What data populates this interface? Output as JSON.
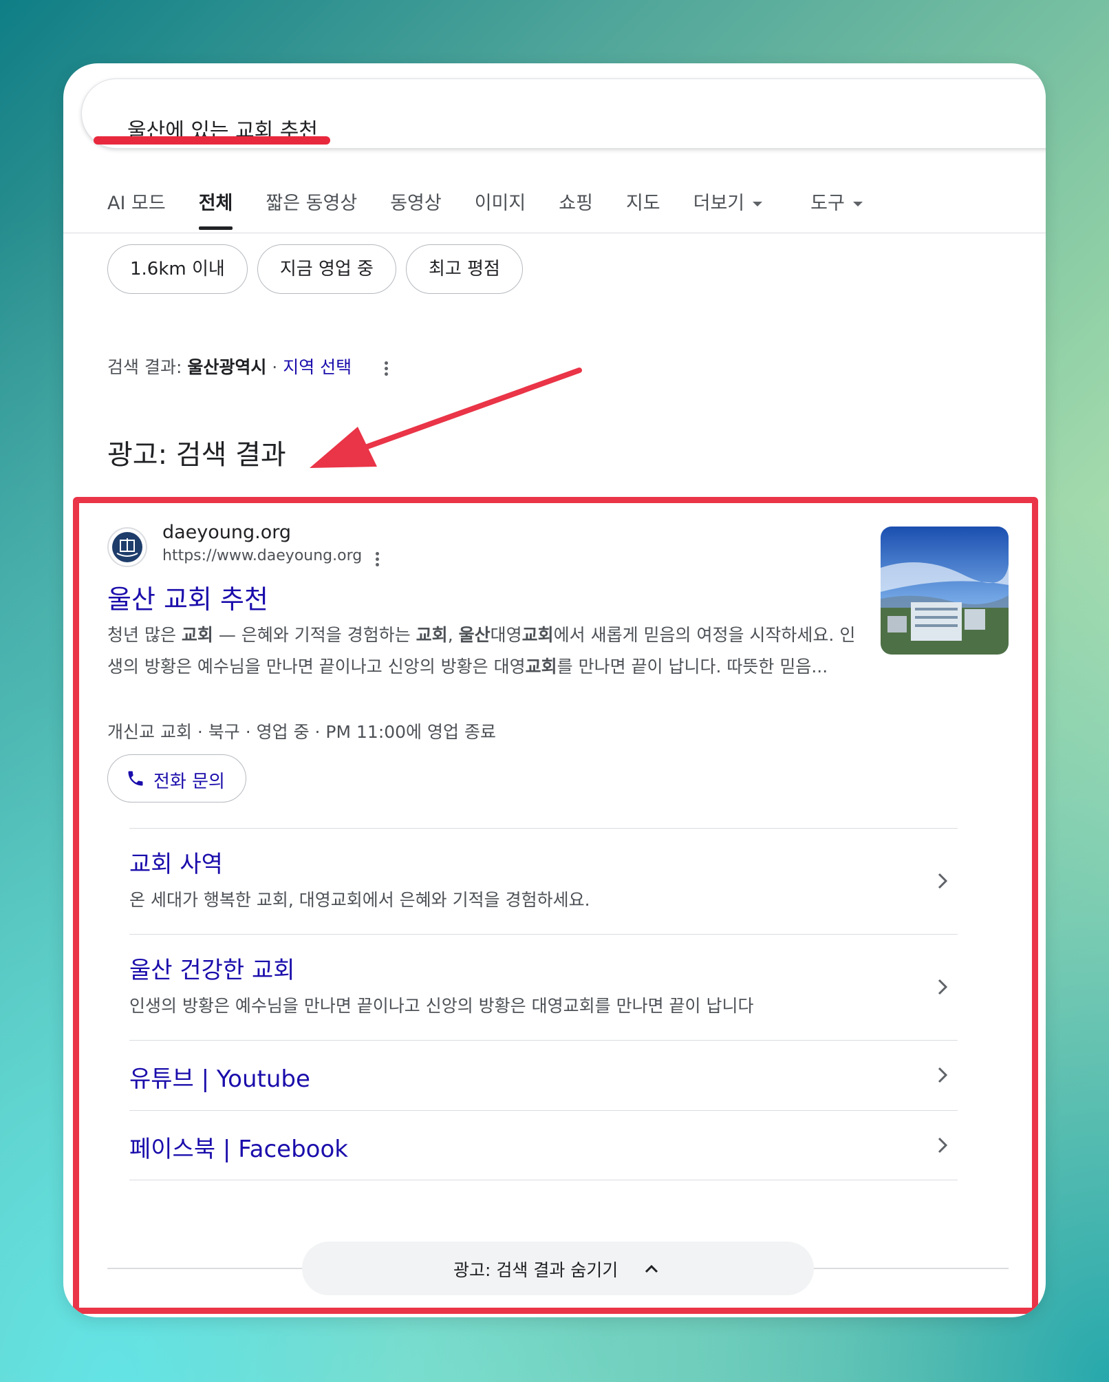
{
  "search": {
    "query": "울산에 있는 교회 추천"
  },
  "tabs": [
    {
      "label": "AI 모드"
    },
    {
      "label": "전체"
    },
    {
      "label": "짧은 동영상"
    },
    {
      "label": "동영상"
    },
    {
      "label": "이미지"
    },
    {
      "label": "쇼핑"
    },
    {
      "label": "지도"
    },
    {
      "label": "더보기"
    },
    {
      "label": "도구"
    }
  ],
  "chips": [
    "1.6km 이내",
    "지금 영업 중",
    "최고 평점"
  ],
  "location": {
    "prefix": "검색 결과: ",
    "place": "울산광역시",
    "separator": " · ",
    "link": "지역 선택"
  },
  "ad_heading": "광고: 검색 결과",
  "result": {
    "site_name": "daeyoung.org",
    "site_url": "https://www.daeyoung.org",
    "title": "울산 교회 추천",
    "snippet_parts": [
      "청년 많은 ",
      "교회",
      " — 은혜와 기적을 경험하는 ",
      "교회",
      ", ",
      "울산",
      "대영",
      "교회",
      "에서 새롭게 믿음의 여정을 시작하세요. 인생의 방황은 예수님을 만나면 끝이나고 신앙의 방황은 대영",
      "교회",
      "를 만나면 끝이 납니다. 따뜻한 믿음..."
    ],
    "meta": "개신교 교회 · 북구 · 영업 중 · PM 11:00에 영업 종료",
    "call_label": "전화 문의"
  },
  "sitelinks": [
    {
      "title": "교회 사역",
      "desc": "온 세대가 행복한 교회, 대영교회에서 은혜와 기적을 경험하세요."
    },
    {
      "title": "울산 건강한 교회",
      "desc": "인생의 방황은 예수님을 만나면 끝이나고 신앙의 방황은 대영교회를 만나면 끝이 납니다"
    },
    {
      "title": "유튜브 | Youtube",
      "desc": ""
    },
    {
      "title": "페이스북 | Facebook",
      "desc": ""
    }
  ],
  "hide_ads_label": "광고: 검색 결과 숨기기",
  "colors": {
    "link": "#1a0dab",
    "annotation_red": "#ea3447"
  }
}
